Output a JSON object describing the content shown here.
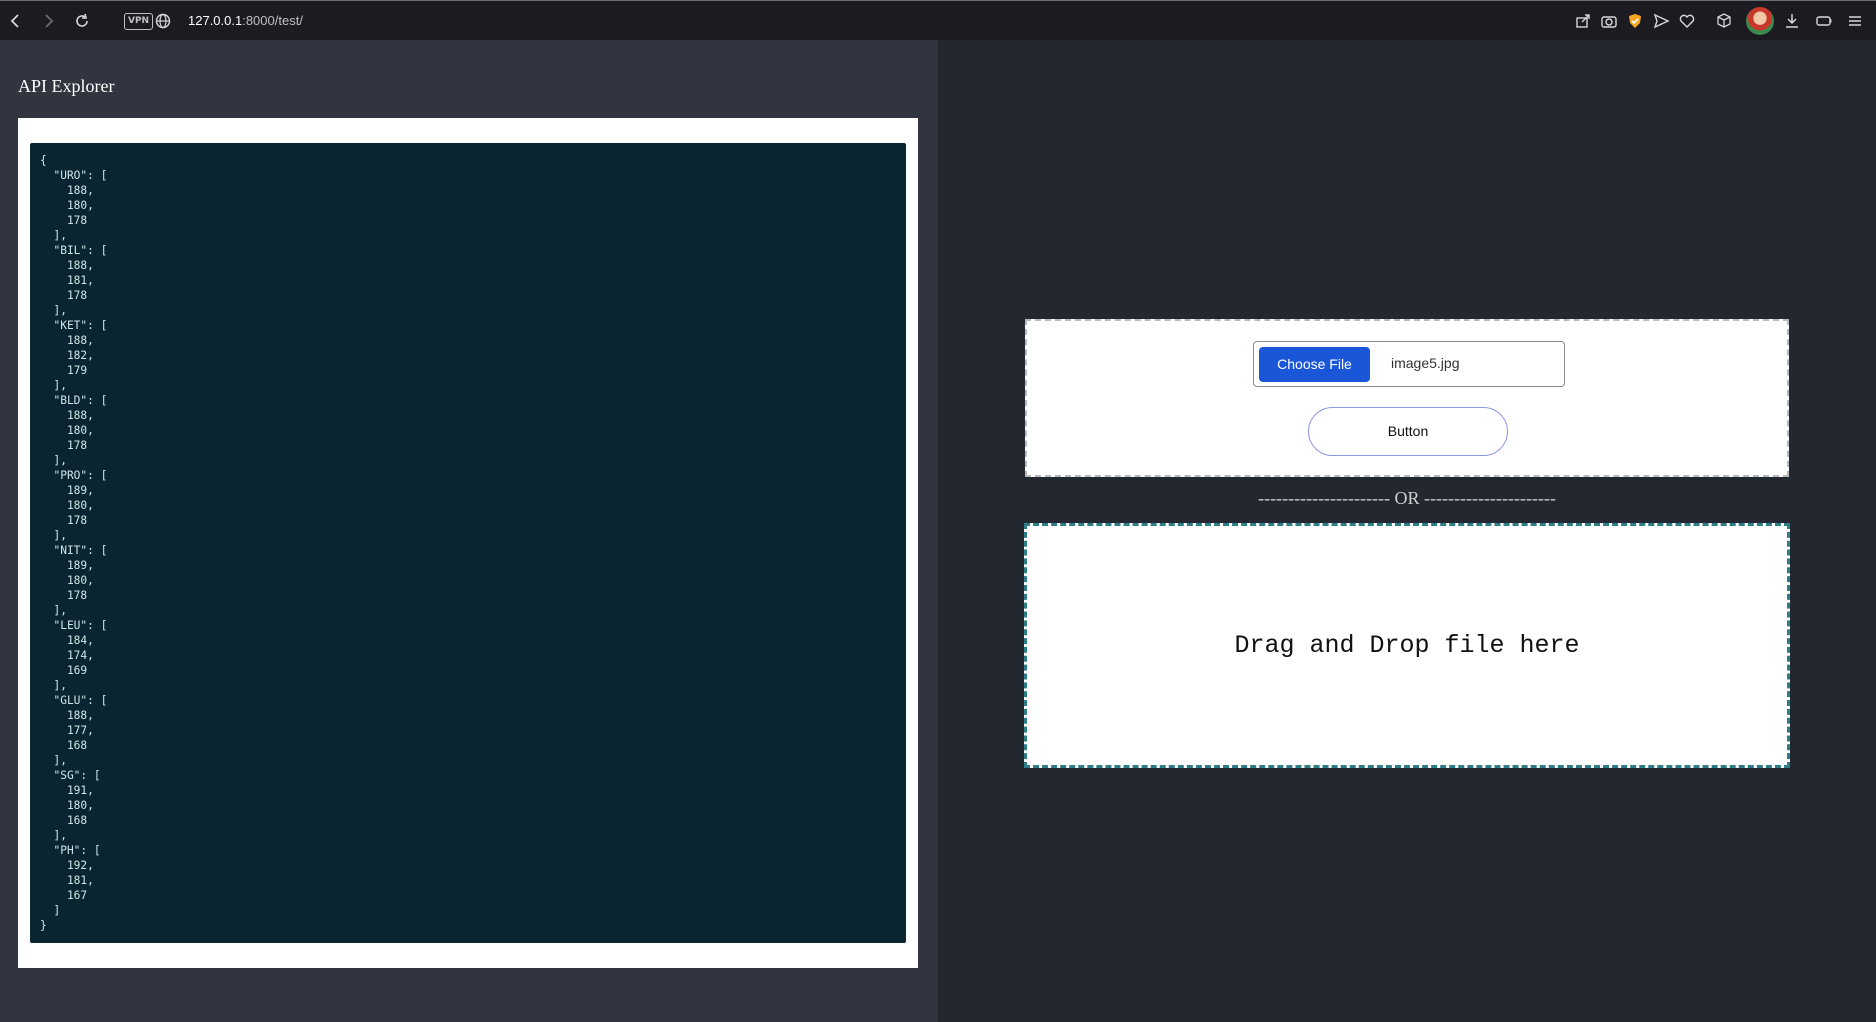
{
  "browser": {
    "vpn_label": "VPN",
    "url_host": "127.0.0.1",
    "url_path": ":8000/test/"
  },
  "page": {
    "title": "API Explorer"
  },
  "json_output": "{\n  \"URO\": [\n    188,\n    180,\n    178\n  ],\n  \"BIL\": [\n    188,\n    181,\n    178\n  ],\n  \"KET\": [\n    188,\n    182,\n    179\n  ],\n  \"BLD\": [\n    188,\n    180,\n    178\n  ],\n  \"PRO\": [\n    189,\n    180,\n    178\n  ],\n  \"NIT\": [\n    189,\n    180,\n    178\n  ],\n  \"LEU\": [\n    184,\n    174,\n    169\n  ],\n  \"GLU\": [\n    188,\n    177,\n    168\n  ],\n  \"SG\": [\n    191,\n    180,\n    168\n  ],\n  \"PH\": [\n    192,\n    181,\n    167\n  ]\n}",
  "upload": {
    "choose_label": "Choose File",
    "file_name": "image5.jpg",
    "button_label": "Button"
  },
  "divider": {
    "text": "----------------------   OR   ----------------------"
  },
  "drop_zone": {
    "text": "Drag and Drop file here"
  },
  "colors": {
    "choose_button": "#1a57d8",
    "json_background": "#0b2432",
    "drop_border": "#2d7d86"
  }
}
